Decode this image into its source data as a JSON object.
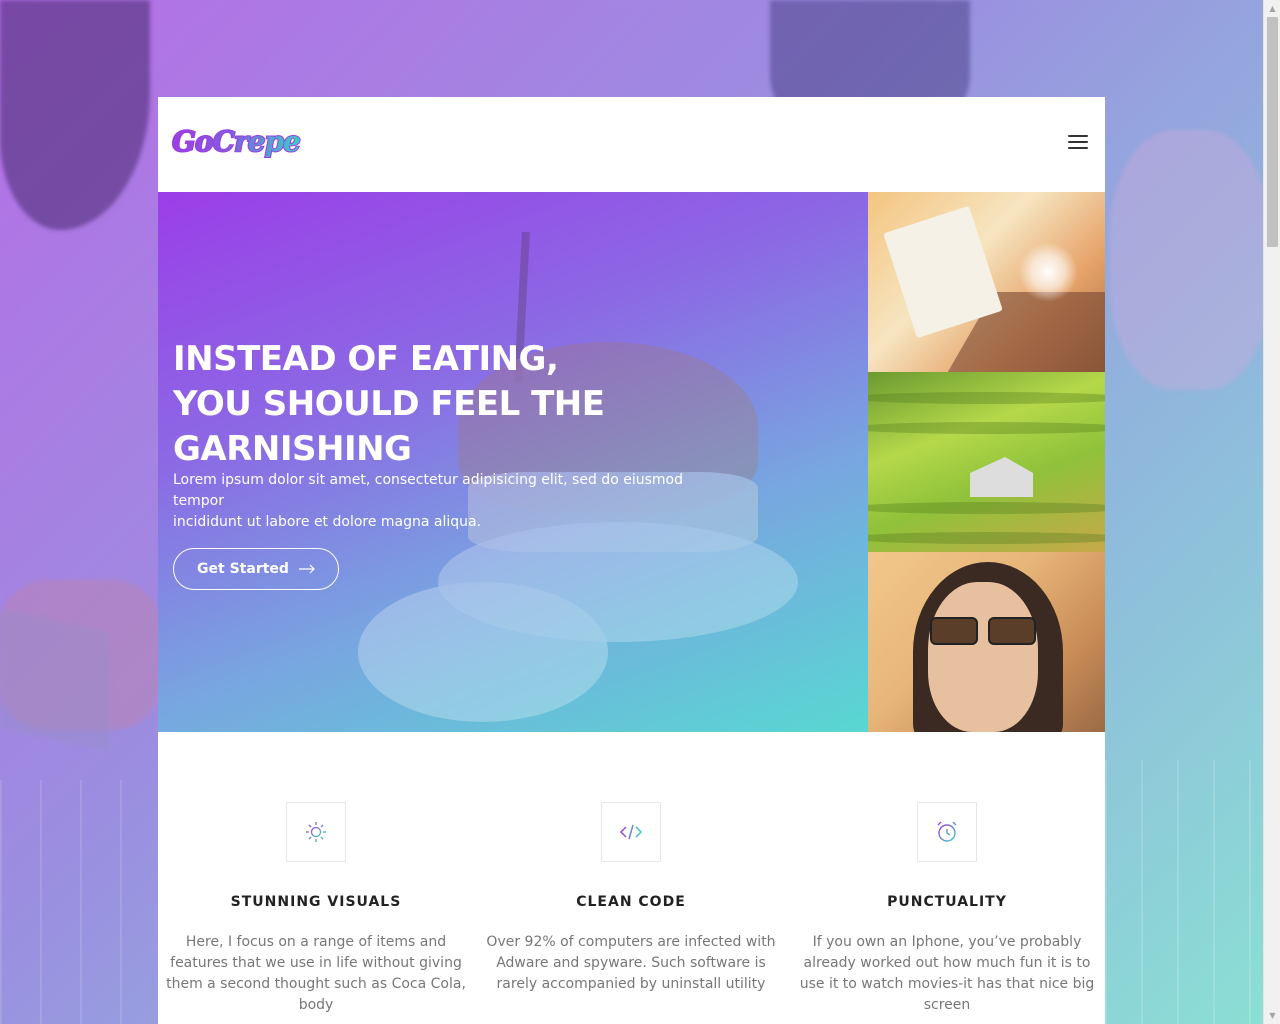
{
  "brand": {
    "logo_text": "GoCrepe"
  },
  "hero": {
    "title": "INSTEAD OF EATING,\nYOU SHOULD FEEL THE\nGARNISHING",
    "text": "Lorem ipsum dolor sit amet, consectetur adipisicing elit, sed do eiusmod tempor\nincididunt ut labore et dolore magna aliqua.",
    "button_label": "Get Started"
  },
  "features": [
    {
      "icon": "sun-icon",
      "title": "STUNNING VISUALS",
      "text": "Here, I focus on a range of items and features that we use in life without giving them a second thought such as Coca Cola, body"
    },
    {
      "icon": "code-icon",
      "title": "CLEAN CODE",
      "text": "Over 92% of computers are infected with Adware and spyware. Such software is rarely accompanied by uninstall utility"
    },
    {
      "icon": "alarm-clock-icon",
      "title": "PUNCTUALITY",
      "text": "If you own an Iphone, you’ve probably already worked out how much fun it is to use it to watch movies-it has that nice big screen"
    }
  ],
  "colors": {
    "gradient_start": "#9b3ee8",
    "gradient_mid": "#78a6e0",
    "gradient_end": "#58d8d2",
    "accent_purple": "#9b3ee0",
    "accent_teal": "#38d0c8"
  }
}
